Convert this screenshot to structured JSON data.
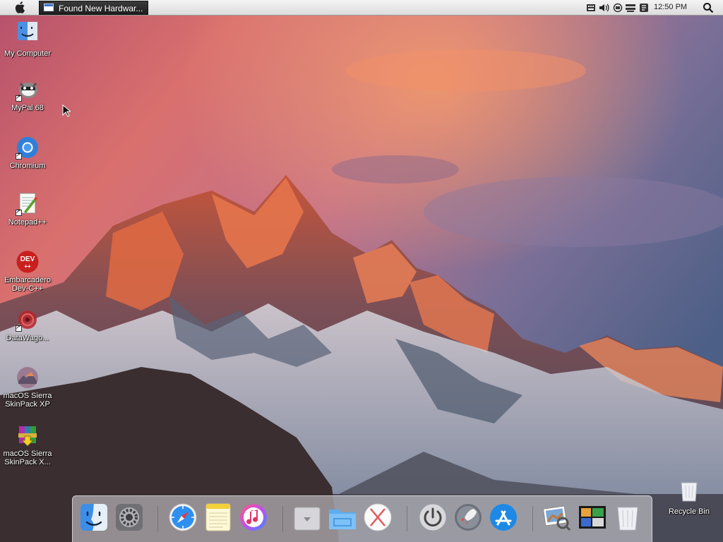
{
  "menubar": {
    "task_button_label": "Found New Hardwar...",
    "clock": "12:50 PM"
  },
  "desktop_icons": [
    {
      "label": "My Computer"
    },
    {
      "label": "MyPal 68"
    },
    {
      "label": "Chromium"
    },
    {
      "label": "Notepad++"
    },
    {
      "label": "Embarcadero Dev-C++",
      "badge": "DEV"
    },
    {
      "label": "DataWago..."
    },
    {
      "label": "macOS Sierra SkinPack XP"
    },
    {
      "label": "macOS Sierra SkinPack X..."
    }
  ],
  "recycle_bin": {
    "label": "Recycle Bin"
  },
  "dock_items": [
    "finder-icon",
    "system-preferences-icon",
    "safari-icon",
    "notes-icon",
    "itunes-icon",
    "download-icon",
    "folder-icon",
    "macos-x-icon",
    "power-icon",
    "launchpad-icon",
    "app-store-icon",
    "preview-icon",
    "photo-booth-icon",
    "trash-icon"
  ],
  "colors": {
    "accent": "#1e88e5",
    "menubar": "#e6e6e6"
  }
}
